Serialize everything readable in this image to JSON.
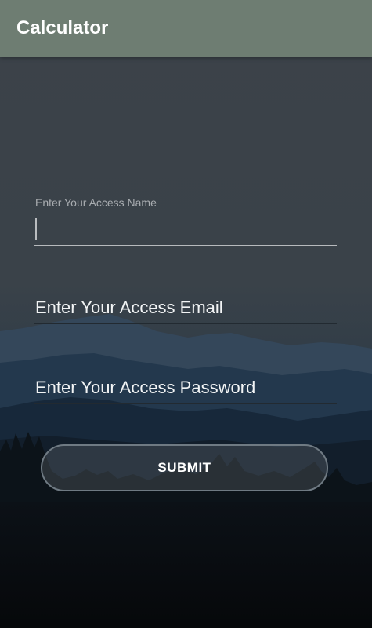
{
  "app": {
    "title": "Calculator"
  },
  "form": {
    "name_label": "Enter Your Access Name",
    "name_value": "",
    "email_hint": "Enter Your Access Email",
    "password_hint": "Enter Your Access Password",
    "submit_label": "SUBMIT"
  },
  "background": {
    "description_icon": "mountain-forest-background"
  },
  "colors": {
    "appbar": "#6e7d72",
    "text": "#ffffff",
    "hint_label": "#a9adb1"
  }
}
